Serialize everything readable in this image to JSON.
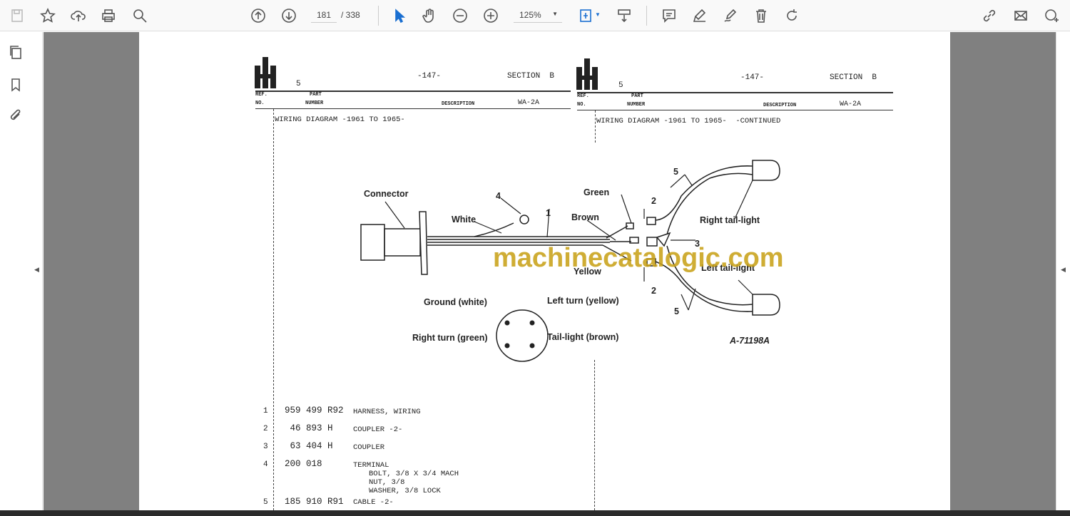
{
  "toolbar": {
    "icons_left": [
      "save-icon",
      "star-icon",
      "cloud-upload-icon",
      "print-icon",
      "search-zoom-icon"
    ],
    "page_current": "181",
    "page_total": "/ 338",
    "zoom": "125%",
    "icons_right": [
      "share-link-icon",
      "email-icon",
      "add-user-icon"
    ]
  },
  "document": {
    "left": {
      "page": "-147-",
      "section": "SECTION  B",
      "five": "5",
      "ref": "REF.",
      "no": "NO.",
      "part": "PART",
      "number": "NUMBER",
      "description": "DESCRIPTION",
      "code": "WA-2A",
      "title": "WIRING DIAGRAM -1961 TO 1965-"
    },
    "right": {
      "page": "-147-",
      "section": "SECTION  B",
      "five": "5",
      "ref": "REF.",
      "no": "NO.",
      "part": "PART",
      "number": "NUMBER",
      "description": "DESCRIPTION",
      "code": "WA-2A",
      "title": "WIRING DIAGRAM -1961 TO 1965-  -CONTINUED"
    },
    "diagram": {
      "connector": "Connector",
      "white": "White",
      "n4": "4",
      "n1": "1",
      "green": "Green",
      "brown": "Brown",
      "yellow": "Yellow",
      "n2a": "2",
      "n2b": "2",
      "n3": "3",
      "n5a": "5",
      "n5b": "5",
      "right_tail": "Right tail-light",
      "left_tail": "Left tail-light",
      "ground": "Ground (white)",
      "left_turn": "Left turn (yellow)",
      "right_turn": "Right turn (green)",
      "tail_brown": "Tail-light (brown)",
      "fig": "A-71198A"
    },
    "watermark": "machinecatalogic.com",
    "parts": [
      {
        "ref": "1",
        "part": "959 499 R92",
        "desc": "HARNESS, WIRING",
        "sub": []
      },
      {
        "ref": "2",
        "part": " 46 893 H",
        "desc": "COUPLER -2-",
        "sub": []
      },
      {
        "ref": "3",
        "part": " 63 404 H",
        "desc": "COUPLER",
        "sub": []
      },
      {
        "ref": "4",
        "part": "200 018",
        "desc": "TERMINAL",
        "sub": [
          "BOLT, 3/8 X 3/4 MACH",
          "NUT, 3/8",
          "WASHER, 3/8 LOCK"
        ]
      },
      {
        "ref": "5",
        "part": "185 910 R91",
        "desc": "CABLE -2-",
        "sub": []
      }
    ]
  }
}
